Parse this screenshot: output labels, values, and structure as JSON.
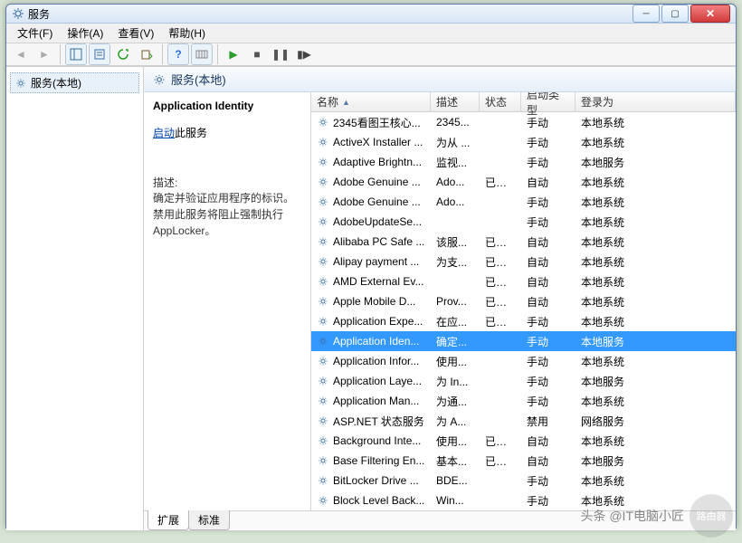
{
  "window": {
    "title": "服务"
  },
  "menu": {
    "file": "文件(F)",
    "action": "操作(A)",
    "view": "查看(V)",
    "help": "帮助(H)"
  },
  "nav": {
    "root": "服务(本地)"
  },
  "category": {
    "header": "服务(本地)"
  },
  "info": {
    "title": "Application Identity",
    "start_link": "启动",
    "start_suffix": "此服务",
    "desc_label": "描述:",
    "desc": "确定并验证应用程序的标识。禁用此服务将阻止强制执行 AppLocker。"
  },
  "columns": {
    "name": "名称",
    "description": "描述",
    "status": "状态",
    "startup": "启动类型",
    "logon": "登录为"
  },
  "tabs": {
    "extended": "扩展",
    "standard": "标准"
  },
  "services": [
    {
      "name": "2345看图王核心...",
      "desc": "2345...",
      "status": "",
      "startup": "手动",
      "logon": "本地系统"
    },
    {
      "name": "ActiveX Installer ...",
      "desc": "为从 ...",
      "status": "",
      "startup": "手动",
      "logon": "本地系统"
    },
    {
      "name": "Adaptive Brightn...",
      "desc": "监视...",
      "status": "",
      "startup": "手动",
      "logon": "本地服务"
    },
    {
      "name": "Adobe Genuine ...",
      "desc": "Ado...",
      "status": "已启动",
      "startup": "自动",
      "logon": "本地系统"
    },
    {
      "name": "Adobe Genuine ...",
      "desc": "Ado...",
      "status": "",
      "startup": "手动",
      "logon": "本地系统"
    },
    {
      "name": "AdobeUpdateSe...",
      "desc": "",
      "status": "",
      "startup": "手动",
      "logon": "本地系统"
    },
    {
      "name": "Alibaba PC Safe ...",
      "desc": "该服...",
      "status": "已启动",
      "startup": "自动",
      "logon": "本地系统"
    },
    {
      "name": "Alipay payment ...",
      "desc": "为支...",
      "status": "已启动",
      "startup": "自动",
      "logon": "本地系统"
    },
    {
      "name": "AMD External Ev...",
      "desc": "",
      "status": "已启动",
      "startup": "自动",
      "logon": "本地系统"
    },
    {
      "name": "Apple Mobile D...",
      "desc": "Prov...",
      "status": "已启动",
      "startup": "自动",
      "logon": "本地系统"
    },
    {
      "name": "Application Expe...",
      "desc": "在应...",
      "status": "已启动",
      "startup": "手动",
      "logon": "本地系统"
    },
    {
      "name": "Application Iden...",
      "desc": "确定...",
      "status": "",
      "startup": "手动",
      "logon": "本地服务",
      "selected": true
    },
    {
      "name": "Application Infor...",
      "desc": "使用...",
      "status": "",
      "startup": "手动",
      "logon": "本地系统"
    },
    {
      "name": "Application Laye...",
      "desc": "为 In...",
      "status": "",
      "startup": "手动",
      "logon": "本地服务"
    },
    {
      "name": "Application Man...",
      "desc": "为通...",
      "status": "",
      "startup": "手动",
      "logon": "本地系统"
    },
    {
      "name": "ASP.NET 状态服务",
      "desc": "为 A...",
      "status": "",
      "startup": "禁用",
      "logon": "网络服务"
    },
    {
      "name": "Background Inte...",
      "desc": "使用...",
      "status": "已启动",
      "startup": "自动",
      "logon": "本地系统"
    },
    {
      "name": "Base Filtering En...",
      "desc": "基本...",
      "status": "已启动",
      "startup": "自动",
      "logon": "本地服务"
    },
    {
      "name": "BitLocker Drive ...",
      "desc": "BDE...",
      "status": "",
      "startup": "手动",
      "logon": "本地系统"
    },
    {
      "name": "Block Level Back...",
      "desc": "Win...",
      "status": "",
      "startup": "手动",
      "logon": "本地系统"
    }
  ],
  "watermark": {
    "text": "头条 @IT电脑小匠",
    "badge": "路由器"
  }
}
